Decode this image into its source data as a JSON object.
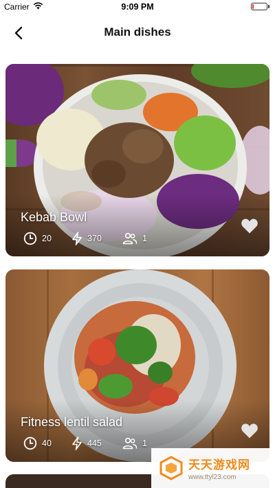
{
  "status_bar": {
    "carrier": "Carrier",
    "time": "9:09 PM",
    "battery_level": 0.12,
    "battery_color": "#e0303a"
  },
  "nav": {
    "title": "Main dishes",
    "back_icon": "chevron-left-icon"
  },
  "dishes": [
    {
      "name": "Kebab Bowl",
      "time": "20",
      "calories": "370",
      "servings": "1",
      "favorite": false
    },
    {
      "name": "Fitness lentil salad",
      "time": "40",
      "calories": "445",
      "servings": "1",
      "favorite": false
    }
  ],
  "stat_icons": [
    "clock-icon",
    "lightning-icon",
    "people-icon"
  ],
  "watermark": {
    "brand": "天天游戏网",
    "url": "www.ttyl23.com"
  }
}
